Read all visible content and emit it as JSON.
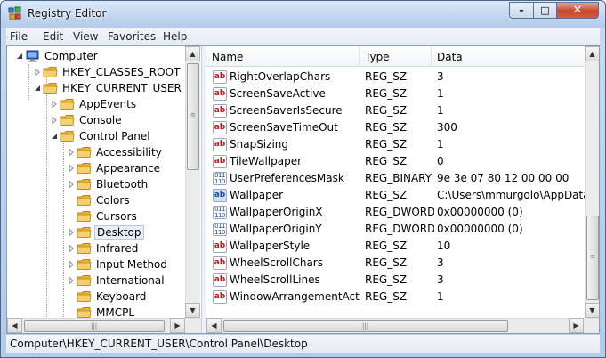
{
  "window": {
    "title": "Registry Editor"
  },
  "controls": {
    "minimize": "–",
    "maximize": "□",
    "close": "✕"
  },
  "menu": [
    "File",
    "Edit",
    "View",
    "Favorites",
    "Help"
  ],
  "tree": {
    "items": [
      {
        "label": "Computer",
        "level": 0,
        "expander": "expanded",
        "icon": "computer-icon"
      },
      {
        "label": "HKEY_CLASSES_ROOT",
        "level": 1,
        "expander": "collapsed",
        "icon": "folder-icon"
      },
      {
        "label": "HKEY_CURRENT_USER",
        "level": 1,
        "expander": "expanded",
        "icon": "folder-icon"
      },
      {
        "label": "AppEvents",
        "level": 2,
        "expander": "collapsed",
        "icon": "folder-icon"
      },
      {
        "label": "Console",
        "level": 2,
        "expander": "collapsed",
        "icon": "folder-icon"
      },
      {
        "label": "Control Panel",
        "level": 2,
        "expander": "expanded",
        "icon": "folder-icon"
      },
      {
        "label": "Accessibility",
        "level": 3,
        "expander": "collapsed",
        "icon": "folder-icon"
      },
      {
        "label": "Appearance",
        "level": 3,
        "expander": "collapsed",
        "icon": "folder-icon"
      },
      {
        "label": "Bluetooth",
        "level": 3,
        "expander": "collapsed",
        "icon": "folder-icon"
      },
      {
        "label": "Colors",
        "level": 3,
        "expander": "none",
        "icon": "folder-icon"
      },
      {
        "label": "Cursors",
        "level": 3,
        "expander": "none",
        "icon": "folder-icon"
      },
      {
        "label": "Desktop",
        "level": 3,
        "expander": "collapsed",
        "icon": "folder-icon",
        "selected": true
      },
      {
        "label": "Infrared",
        "level": 3,
        "expander": "collapsed",
        "icon": "folder-icon"
      },
      {
        "label": "Input Method",
        "level": 3,
        "expander": "collapsed",
        "icon": "folder-icon"
      },
      {
        "label": "International",
        "level": 3,
        "expander": "collapsed",
        "icon": "folder-icon"
      },
      {
        "label": "Keyboard",
        "level": 3,
        "expander": "none",
        "icon": "folder-icon"
      },
      {
        "label": "MMCPL",
        "level": 3,
        "expander": "none",
        "icon": "folder-icon"
      }
    ]
  },
  "list": {
    "columns": [
      "Name",
      "Type",
      "Data"
    ],
    "rows": [
      {
        "name": "RightOverlapChars",
        "type": "REG_SZ",
        "data": "3",
        "icon": "string-value-icon"
      },
      {
        "name": "ScreenSaveActive",
        "type": "REG_SZ",
        "data": "1",
        "icon": "string-value-icon"
      },
      {
        "name": "ScreenSaverIsSecure",
        "type": "REG_SZ",
        "data": "1",
        "icon": "string-value-icon"
      },
      {
        "name": "ScreenSaveTimeOut",
        "type": "REG_SZ",
        "data": "300",
        "icon": "string-value-icon"
      },
      {
        "name": "SnapSizing",
        "type": "REG_SZ",
        "data": "1",
        "icon": "string-value-icon"
      },
      {
        "name": "TileWallpaper",
        "type": "REG_SZ",
        "data": "0",
        "icon": "string-value-icon"
      },
      {
        "name": "UserPreferencesMask",
        "type": "REG_BINARY",
        "data": "9e 3e 07 80 12 00 00 00",
        "icon": "binary-value-icon"
      },
      {
        "name": "Wallpaper",
        "type": "REG_SZ",
        "data": "C:\\Users\\mmurgolo\\AppData\\R",
        "icon": "string-value-selected-icon"
      },
      {
        "name": "WallpaperOriginX",
        "type": "REG_DWORD",
        "data": "0x00000000 (0)",
        "icon": "binary-value-icon"
      },
      {
        "name": "WallpaperOriginY",
        "type": "REG_DWORD",
        "data": "0x00000000 (0)",
        "icon": "binary-value-icon"
      },
      {
        "name": "WallpaperStyle",
        "type": "REG_SZ",
        "data": "10",
        "icon": "string-value-icon"
      },
      {
        "name": "WheelScrollChars",
        "type": "REG_SZ",
        "data": "3",
        "icon": "string-value-icon"
      },
      {
        "name": "WheelScrollLines",
        "type": "REG_SZ",
        "data": "3",
        "icon": "string-value-icon"
      },
      {
        "name": "WindowArrangementActive",
        "type": "REG_SZ",
        "data": "1",
        "icon": "string-value-icon"
      }
    ]
  },
  "icon_glyphs": {
    "string": "ab",
    "binary_top": "011",
    "binary_bottom": "110"
  },
  "status": {
    "path": "Computer\\HKEY_CURRENT_USER\\Control Panel\\Desktop"
  },
  "colors": {
    "selection": "#e7eef7",
    "string_icon": "#c0181d",
    "binary_icon": "#1f4da3",
    "close_button": "#c8452c"
  }
}
